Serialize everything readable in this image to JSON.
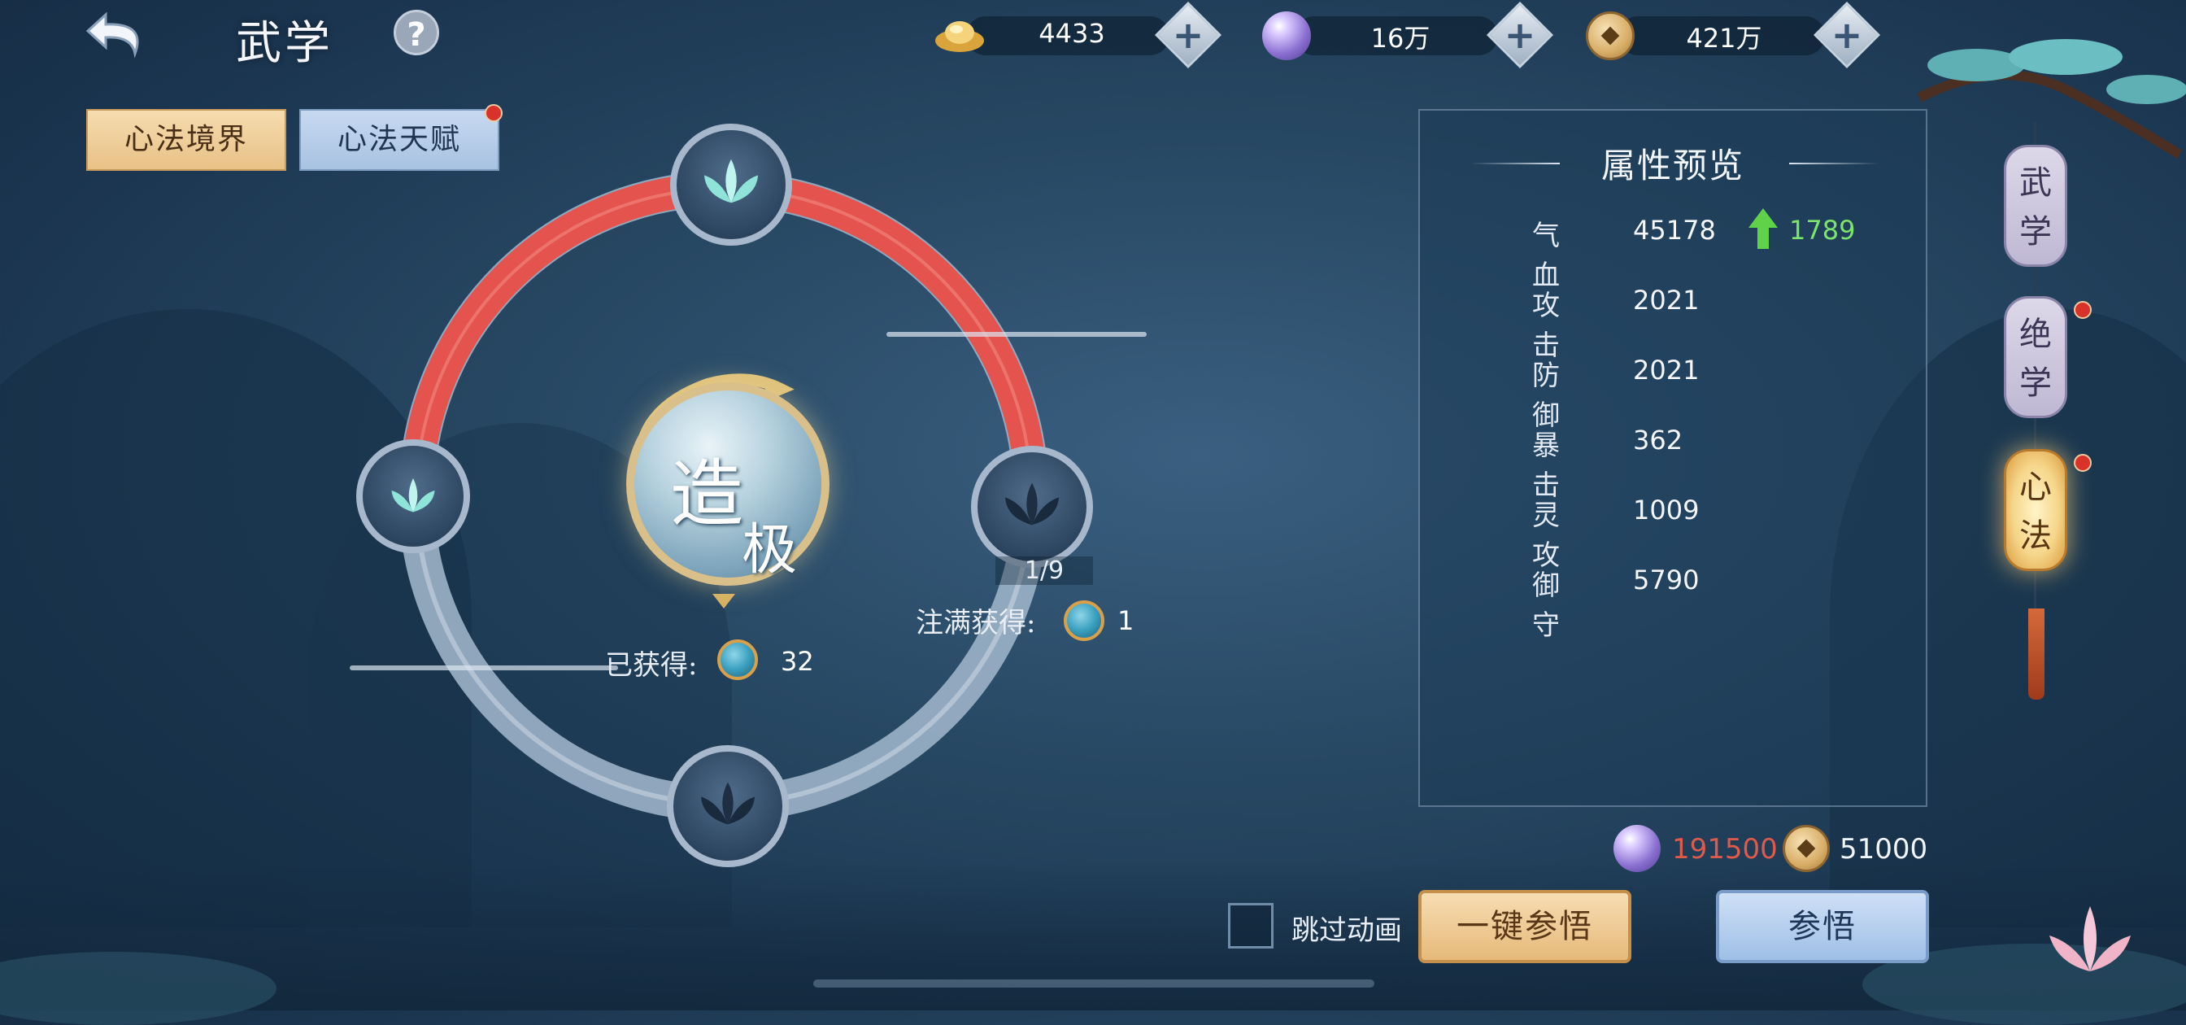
{
  "header": {
    "title": "武学",
    "back_icon": "back-arrow-icon",
    "help_label": "?"
  },
  "currencies": [
    {
      "icon": "gold-ingot-icon",
      "value": "4433"
    },
    {
      "icon": "spirit-orb-icon",
      "value": "16万"
    },
    {
      "icon": "copper-coin-icon",
      "value": "421万"
    }
  ],
  "tabs": [
    {
      "label": "心法境界",
      "active": true
    },
    {
      "label": "心法天赋",
      "active": false,
      "badge": true
    }
  ],
  "ring": {
    "center_text_1": "造",
    "center_text_2": "极",
    "progress": "1/9",
    "fill_label": "注满获得:",
    "fill_value": "1",
    "owned_label": "已获得:",
    "owned_value": "32"
  },
  "attributes": {
    "title": "属性预览",
    "rows": [
      {
        "name": "气血",
        "value": "45178",
        "increase": "1789"
      },
      {
        "name": "攻击",
        "value": "2021"
      },
      {
        "name": "防御",
        "value": "2021"
      },
      {
        "name": "暴击",
        "value": "362"
      },
      {
        "name": "灵攻",
        "value": "1009"
      },
      {
        "name": "御守",
        "value": "5790"
      }
    ]
  },
  "cost": {
    "orb_value": "191500",
    "orb_color": "#e05a4c",
    "coin_value": "51000"
  },
  "actions": {
    "skip_label": "跳过动画",
    "one_click_label": "一键参悟",
    "comprehend_label": "参悟"
  },
  "side_nav": [
    {
      "label_1": "武",
      "label_2": "学"
    },
    {
      "label_1": "绝",
      "label_2": "学",
      "badge": true
    },
    {
      "label_1": "心",
      "label_2": "法",
      "badge": true,
      "active": true
    }
  ],
  "colors": {
    "ring_active": "#e4534e",
    "increase_green": "#7ee36c"
  }
}
